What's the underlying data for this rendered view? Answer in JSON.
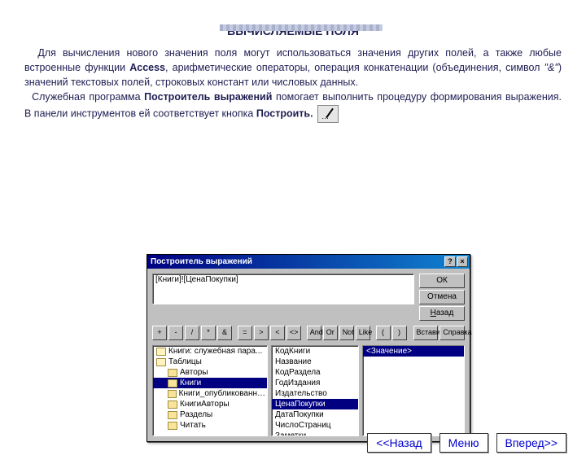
{
  "title": "ВЫЧИСЛЯЕМЫЕ ПОЛЯ",
  "paragraph": {
    "p1a": "Для вычисления нового значения поля могут использоваться значения других полей, а также любые встроенные функции ",
    "p1b": "Access",
    "p1c": ", арифметические операторы, операция конкатенации (объединения, символ ",
    "p1d": "\"&\"",
    "p1e": ") значений текстовых полей, строковых констант или числовых данных.",
    "p2a": "Служебная программа ",
    "p2b": "Построитель выражений",
    "p2c": " помогает выполнить процедуру формирования выражения. В панели инструментов ей соответствует кнопка ",
    "p2d": "Построить.",
    "p2e": ""
  },
  "builder": {
    "title": "Построитель выражений",
    "expr": "[Книги]![ЦенаПокупки]",
    "side": {
      "ok": "ОК",
      "cancel": "Отмена",
      "back": "Назад"
    },
    "ops": [
      "+",
      "-",
      "/",
      "*",
      "&",
      "=",
      ">",
      "<",
      "<>",
      "And",
      "Or",
      "Not",
      "Like",
      "(",
      ")"
    ],
    "paste": "Вставить",
    "help": "Справка",
    "tree": [
      {
        "label": "Книги: служебная пара...",
        "indent": false,
        "open": true
      },
      {
        "label": "Таблицы",
        "indent": false,
        "open": true
      },
      {
        "label": "Авторы",
        "indent": true
      },
      {
        "label": "Книги",
        "indent": true,
        "sel": true
      },
      {
        "label": "Книги_опубликованн…",
        "indent": true
      },
      {
        "label": "КнигиАвторы",
        "indent": true
      },
      {
        "label": "Разделы",
        "indent": true
      },
      {
        "label": "Читать",
        "indent": true
      }
    ],
    "fields": [
      {
        "label": "КодКниги"
      },
      {
        "label": "Название"
      },
      {
        "label": "КодРаздела"
      },
      {
        "label": "ГодИздания"
      },
      {
        "label": "Издательство"
      },
      {
        "label": "ЦенаПокупки",
        "sel": true
      },
      {
        "label": "ДатаПокупки"
      },
      {
        "label": "ЧислоСтраниц"
      },
      {
        "label": "Заметки"
      }
    ],
    "value": "<Значение>"
  },
  "nav": {
    "back": "<<Назад",
    "menu": "Меню",
    "next": "Вперед>>"
  }
}
